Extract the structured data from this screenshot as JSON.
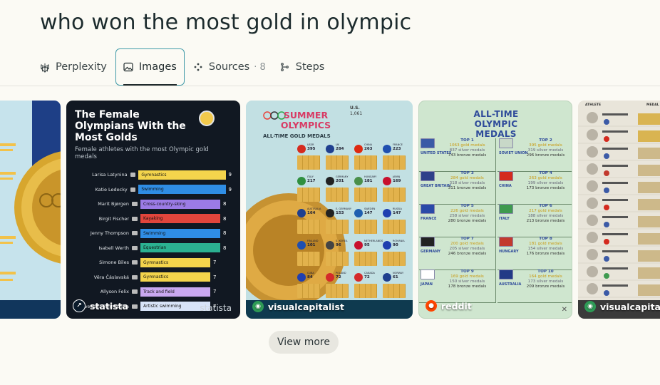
{
  "query": "who won the most gold in olympic",
  "tabs": {
    "perplexity": "Perplexity",
    "images": "Images",
    "sources": "Sources",
    "sources_count": "· 8",
    "steps": "Steps"
  },
  "cards": {
    "c1": {},
    "c2": {
      "title": "The Female Olympians With the Most Golds",
      "subtitle": "Female athletes with the most Olympic gold medals",
      "rows": [
        {
          "name": "Larisa Latynina",
          "sport": "Gymnastics",
          "value": "9",
          "color": "#f4d44c"
        },
        {
          "name": "Katie Ledecky",
          "sport": "Swimming",
          "value": "9",
          "color": "#2f8de4"
        },
        {
          "name": "Marit Bjørgen",
          "sport": "Cross-country-sking",
          "value": "8",
          "color": "#9b7be6"
        },
        {
          "name": "Birgit Fischer",
          "sport": "Kayaking",
          "value": "8",
          "color": "#e2453c"
        },
        {
          "name": "Jenny Thompson",
          "sport": "Swimming",
          "value": "8",
          "color": "#2f8de4"
        },
        {
          "name": "Isabell Werth",
          "sport": "Equestrian",
          "value": "8",
          "color": "#2bb191"
        },
        {
          "name": "Simone Biles",
          "sport": "Gymnastics",
          "value": "7",
          "color": "#f4d44c"
        },
        {
          "name": "Věra Čáslavská",
          "sport": "Gymnastics",
          "value": "7",
          "color": "#f4d44c"
        },
        {
          "name": "Allyson Felix",
          "sport": "Track and field",
          "value": "7",
          "color": "#c9a8f0"
        },
        {
          "name": "Svetlana Romashina",
          "sport": "Artistic swimming",
          "value": "7",
          "color": "#d8e4f8"
        }
      ],
      "source_name": "statista",
      "watermark": "statista"
    },
    "c3": {
      "title": "SUMMER OLYMPICS",
      "subtitle": "ALL-TIME GOLD MEDALS",
      "countries": [
        {
          "name": "USSR",
          "value": "395"
        },
        {
          "name": "UK",
          "value": "284"
        },
        {
          "name": "CHINA",
          "value": "263"
        },
        {
          "name": "FRANCE",
          "value": "223"
        },
        {
          "name": "ITALY",
          "value": "217"
        },
        {
          "name": "GERMANY",
          "value": "201"
        },
        {
          "name": "HUNGARY",
          "value": "181"
        },
        {
          "name": "JAPAN",
          "value": "169"
        },
        {
          "name": "AUSTRALIA",
          "value": "164"
        },
        {
          "name": "E. GERMANY",
          "value": "153"
        },
        {
          "name": "SWEDEN",
          "value": "147"
        },
        {
          "name": "RUSSIA",
          "value": "147"
        },
        {
          "name": "FINLAND",
          "value": "101"
        },
        {
          "name": "S. KOREA",
          "value": "96"
        },
        {
          "name": "NETHERLANDS",
          "value": "95"
        },
        {
          "name": "ROMANIA",
          "value": "90"
        },
        {
          "name": "CUBA",
          "value": "84"
        },
        {
          "name": "POLAND",
          "value": "72"
        },
        {
          "name": "CANADA",
          "value": "72"
        },
        {
          "name": "NORWAY",
          "value": "61"
        }
      ],
      "usa_label": "U.S.",
      "usa_value": "1,061",
      "source_name": "visualcapitalist"
    },
    "c4": {
      "title": "ALL-TIME OLYMPIC MEDALS",
      "cells": [
        {
          "top": "TOP 1",
          "gold": "1063 gold medals",
          "silver": "837 silver medals",
          "bronze": "743 bronze medals",
          "country": "UNITED STATES",
          "flag": "#3b5aa6"
        },
        {
          "top": "TOP 2",
          "gold": "395 gold medals",
          "silver": "319 silver medals",
          "bronze": "296 bronze medals",
          "country": "SOVIET UNION",
          "flag": "#c8d8c8"
        },
        {
          "top": "TOP 3",
          "gold": "284 gold medals",
          "silver": "318 silver medals",
          "bronze": "311 bronze medals",
          "country": "GREAT BRITAIN",
          "flag": "#2e3f8a"
        },
        {
          "top": "TOP 4",
          "gold": "263 gold medals",
          "silver": "199 silver medals",
          "bronze": "173 bronze medals",
          "country": "CHINA",
          "flag": "#d42a1e"
        },
        {
          "top": "TOP 5",
          "gold": "226 gold medals",
          "silver": "258 silver medals",
          "bronze": "280 bronze medals",
          "country": "FRANCE",
          "flag": "#2a4aa8"
        },
        {
          "top": "TOP 6",
          "gold": "217 gold medals",
          "silver": "188 silver medals",
          "bronze": "213 bronze medals",
          "country": "ITALY",
          "flag": "#3f9a4f"
        },
        {
          "top": "TOP 7",
          "gold": "200 gold medals",
          "silver": "205 silver medals",
          "bronze": "246 bronze medals",
          "country": "GERMANY",
          "flag": "#222222"
        },
        {
          "top": "TOP 8",
          "gold": "181 gold medals",
          "silver": "154 silver medals",
          "bronze": "176 bronze medals",
          "country": "HUNGARY",
          "flag": "#c23a2e"
        },
        {
          "top": "TOP 9",
          "gold": "169 gold medals",
          "silver": "150 silver medals",
          "bronze": "178 bronze medals",
          "country": "JAPAN",
          "flag": "#ffffff"
        },
        {
          "top": "TOP 10",
          "gold": "164 gold medals",
          "silver": "173 silver medals",
          "bronze": "209 bronze medals",
          "country": "AUSTRALIA",
          "flag": "#223a86"
        }
      ],
      "source_name": "reddit"
    },
    "c5": {
      "header_left": "ATHLETE",
      "header_right": "MEDAL",
      "source_name": "visualcapitalist"
    }
  },
  "view_more": "View more",
  "colors": {
    "accent_border": "#3f9aa8",
    "background": "#fbfaf4"
  }
}
